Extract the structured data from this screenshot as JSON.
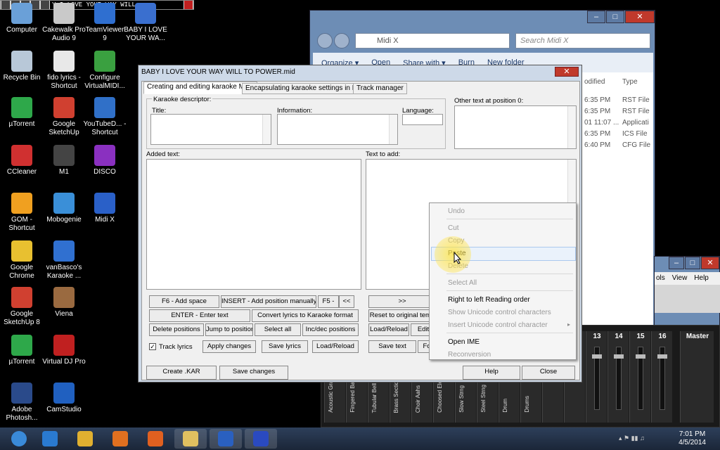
{
  "miniplayer": {
    "text": "Y I LOVE YOUR WAY WILL"
  },
  "desktop_icons": [
    {
      "label": "Computer",
      "icon": "computer-icon",
      "color": "#6aa0d8"
    },
    {
      "label": "Cakewalk Pro Audio 9",
      "icon": "cakewalk-icon",
      "color": "#c9c9c9"
    },
    {
      "label": "TeamViewer 9",
      "icon": "teamviewer-icon",
      "color": "#2f6fd0"
    },
    {
      "label": "BABY I LOVE YOUR WA...",
      "icon": "midi-file-icon",
      "color": "#3a6fcf"
    },
    {
      "label": "Recycle Bin",
      "icon": "recycle-bin-icon",
      "color": "#b8c8d8"
    },
    {
      "label": "fido lyrics - Shortcut",
      "icon": "text-file-icon",
      "color": "#e8e8e8"
    },
    {
      "label": "Configure VirtualMIDI...",
      "icon": "config-icon",
      "color": "#3aa040"
    },
    {
      "label": "µTorrent",
      "icon": "utorrent-icon",
      "color": "#2ea84a"
    },
    {
      "label": "Google SketchUp",
      "icon": "sketchup-icon",
      "color": "#d04030"
    },
    {
      "label": "YouTubeD... - Shortcut",
      "icon": "youtube-downloader-icon",
      "color": "#3070c8"
    },
    {
      "label": "CCleaner",
      "icon": "ccleaner-icon",
      "color": "#d03030"
    },
    {
      "label": "M1",
      "icon": "korg-m1-icon",
      "color": "#444444"
    },
    {
      "label": "DISCO",
      "icon": "disco-icon",
      "color": "#8a30c0"
    },
    {
      "label": "GOM - Shortcut",
      "icon": "gom-player-icon",
      "color": "#f0a020"
    },
    {
      "label": "Mobogenie",
      "icon": "mobogenie-icon",
      "color": "#3a8fd8"
    },
    {
      "label": "Midi X",
      "icon": "midi-x-icon",
      "color": "#2a60c8"
    },
    {
      "label": "Google Chrome",
      "icon": "chrome-icon",
      "color": "#e8c030"
    },
    {
      "label": "vanBasco's Karaoke ...",
      "icon": "vanbasco-icon",
      "color": "#3070d0"
    },
    {
      "label": "Google SketchUp 8",
      "icon": "sketchup8-icon",
      "color": "#d04030"
    },
    {
      "label": "Viena",
      "icon": "viena-icon",
      "color": "#9a6a40"
    },
    {
      "label": "µTorrent",
      "icon": "utorrent-icon",
      "color": "#2ea84a"
    },
    {
      "label": "Virtual DJ Pro",
      "icon": "virtual-dj-icon",
      "color": "#c02020"
    },
    {
      "label": "Adobe Photosh...",
      "icon": "photoshop-icon",
      "color": "#2a4a8a"
    },
    {
      "label": "CamStudio",
      "icon": "camstudio-icon",
      "color": "#2060c0"
    }
  ],
  "explorer": {
    "address": "Midi X",
    "search_placeholder": "Search Midi X",
    "commands": [
      "Organize ▾",
      "Open",
      "Share with ▾",
      "Burn",
      "New folder"
    ],
    "col_modified": "odified",
    "col_type": "Type",
    "rows": [
      {
        "date": "6:35 PM",
        "type": "RST File"
      },
      {
        "date": "6:35 PM",
        "type": "RST File"
      },
      {
        "date": "01 11:07 ...",
        "type": "Applicati"
      },
      {
        "date": "6:35 PM",
        "type": "ICS File"
      },
      {
        "date": "6:40 PM",
        "type": "CFG File"
      }
    ]
  },
  "midix": {
    "menu": [
      "ols",
      "View",
      "Help"
    ]
  },
  "mixer": {
    "channel_numbers": [
      "13",
      "14",
      "15",
      "16"
    ],
    "master_label": "Master",
    "channel_names": [
      "Acoustic Gra",
      "Fingered Bas",
      "Tubular Bell",
      "Brass Section",
      "Choir Aahs",
      "Choosed Ele",
      "Slow Strng",
      "Steel Strng",
      "Drum",
      "Drums"
    ]
  },
  "dialog": {
    "title": "BABY I LOVE YOUR WAY WILL TO POWER.mid",
    "tabs": [
      "Creating and editing karaoke MIDI",
      "Encapsulating karaoke settings in MIDI",
      "Track manager"
    ],
    "descriptor_label": "Karaoke descriptor:",
    "title_label": "Title:",
    "information_label": "Information:",
    "language_label": "Language:",
    "other_text_label": "Other text at position 0:",
    "added_text_label": "Added text:",
    "text_to_add_label": "Text to add:",
    "buttons": {
      "f6": "F6 - Add space",
      "insert": "INSERT - Add position manually",
      "f5": "F5 -",
      "prev": "<<",
      "next": ">>",
      "enter": "ENTER - Enter text",
      "convert": "Convert lyrics to Karaoke format",
      "reset": "Reset to original temp",
      "delete_positions": "Delete positions",
      "jump": "Jump to position",
      "select_all": "Select all",
      "incdec": "Inc/dec positions",
      "load_reload_right": "Load/Reload",
      "edit": "Edit",
      "apply": "Apply changes",
      "save_lyrics": "Save lyrics",
      "load_reload": "Load/Reload",
      "save_text": "Save text",
      "fo": "Fo",
      "create_kar": "Create .KAR",
      "save_changes": "Save changes",
      "help": "Help",
      "close": "Close"
    },
    "track_lyrics_label": "Track lyrics",
    "track_lyrics_checked": true
  },
  "context_menu": {
    "items": [
      {
        "label": "Undo",
        "enabled": false
      },
      {
        "label": "Cut",
        "enabled": false
      },
      {
        "label": "Copy",
        "enabled": false
      },
      {
        "label": "Paste",
        "enabled": true,
        "highlighted": true
      },
      {
        "label": "Delete",
        "enabled": false
      },
      {
        "label": "Select All",
        "enabled": false
      },
      {
        "label": "Right to left Reading order",
        "enabled": true
      },
      {
        "label": "Show Unicode control characters",
        "enabled": false
      },
      {
        "label": "Insert Unicode control character",
        "enabled": false,
        "submenu": true
      },
      {
        "label": "Open IME",
        "enabled": true
      },
      {
        "label": "Reconversion",
        "enabled": false
      }
    ]
  },
  "taskbar": {
    "items": [
      {
        "icon": "start-orb-icon",
        "color": "#3a8ad8"
      },
      {
        "icon": "internet-explorer-icon",
        "color": "#2a7ad0"
      },
      {
        "icon": "chrome-icon",
        "color": "#e0b030"
      },
      {
        "icon": "media-player-icon",
        "color": "#e07020"
      },
      {
        "icon": "firefox-icon",
        "color": "#e06020"
      },
      {
        "icon": "explorer-folder-icon",
        "color": "#e0c060"
      },
      {
        "icon": "camstudio-icon",
        "color": "#2a60c0"
      },
      {
        "icon": "midi-x-icon",
        "color": "#2a4ac0"
      }
    ],
    "time": "7:01 PM",
    "date": "4/5/2014"
  }
}
